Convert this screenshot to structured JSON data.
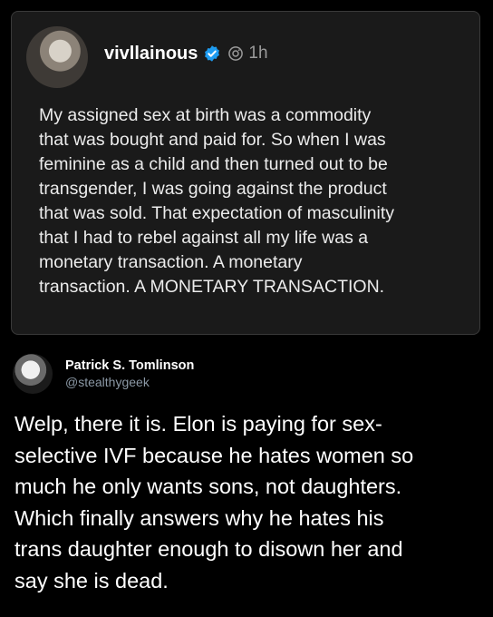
{
  "quoted_post": {
    "username": "vivllainous",
    "time": "1h",
    "body": "My assigned sex at birth was a commodity\nthat was bought and paid for. So when I was\nfeminine as a child and then turned out to be\ntransgender, I was going against the product\nthat was sold. That expectation of masculinity\nthat I had to rebel against all my life was a\nmonetary transaction. A monetary\ntransaction. A MONETARY TRANSACTION."
  },
  "post": {
    "display_name": "Patrick S. Tomlinson",
    "handle": "@stealthygeek",
    "body": "Welp, there it is. Elon is paying for sex-\nselective IVF because he hates women so\nmuch he only wants sons, not daughters.\nWhich finally answers why he hates his\ntrans daughter enough to disown her and\nsay she is dead."
  },
  "icons": {
    "verified": "verified-badge-icon",
    "camera": "camera-icon"
  },
  "colors": {
    "background": "#000000",
    "card": "#1a1a1a",
    "verified": "#1d9bf0",
    "muted": "#9a9a9a"
  }
}
